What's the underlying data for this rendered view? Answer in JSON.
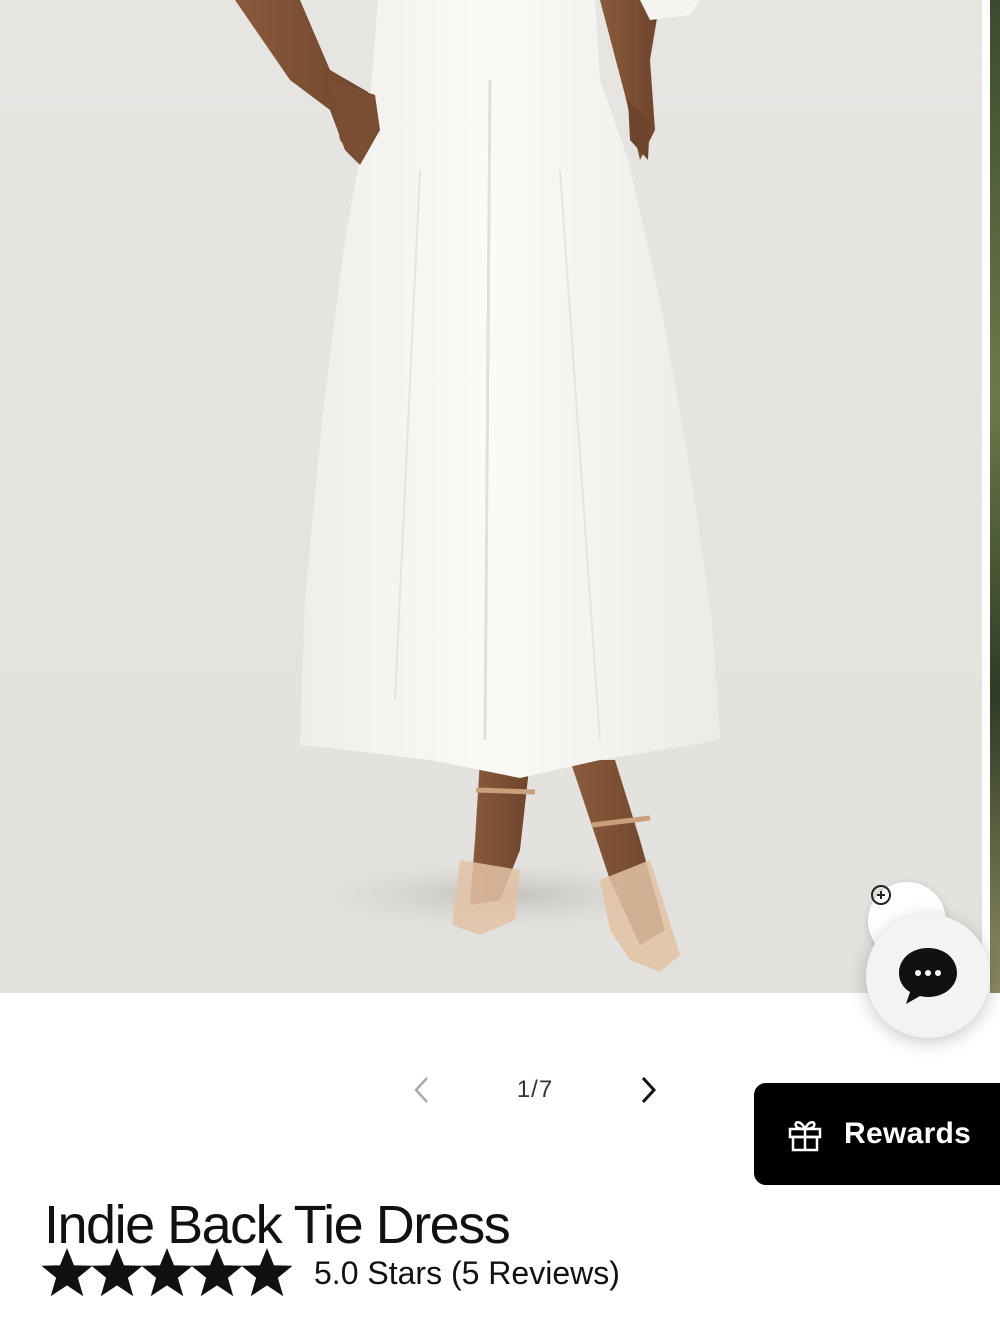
{
  "product": {
    "title": "Indie Back Tie Dress",
    "rating_value": 5,
    "rating_max": 5,
    "rating_text": "5.0 Stars (5 Reviews)"
  },
  "gallery": {
    "counter": "1/7",
    "image_alt": "Model wearing white A-line midi dress with nude clear-strap heels"
  },
  "rewards": {
    "label": "Rewards",
    "icon": "gift-icon"
  },
  "chat": {
    "icon": "chat-bubble-icon"
  },
  "zoom": {
    "icon": "zoom-icon"
  },
  "colors": {
    "background": "#ffffff",
    "hero_background": "#e5e4e0",
    "rewards_bg": "#000000",
    "text": "#111111"
  }
}
